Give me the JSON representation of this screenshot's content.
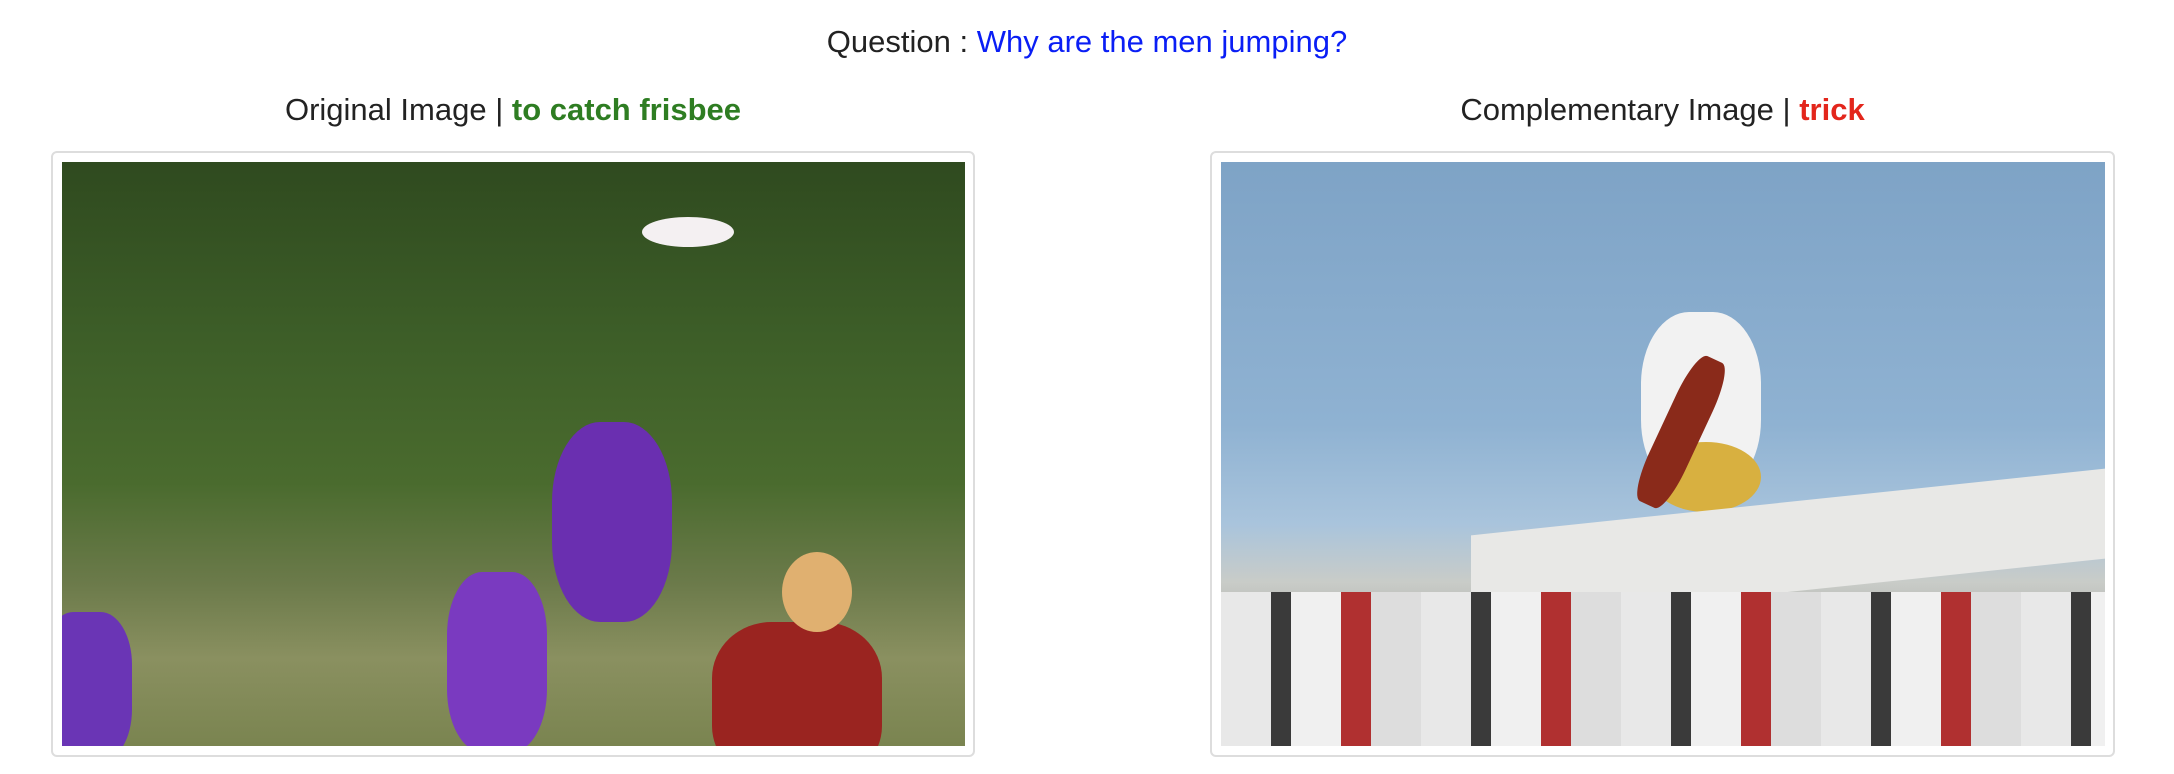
{
  "question": {
    "label": "Question :",
    "text": "Why are the men jumping?"
  },
  "original": {
    "label": "Original Image",
    "separator": "|",
    "answer": "to catch frisbee",
    "answer_color": "#2e7d22"
  },
  "complementary": {
    "label": "Complementary Image",
    "separator": "|",
    "answer": "trick",
    "answer_color": "#e3261c"
  }
}
